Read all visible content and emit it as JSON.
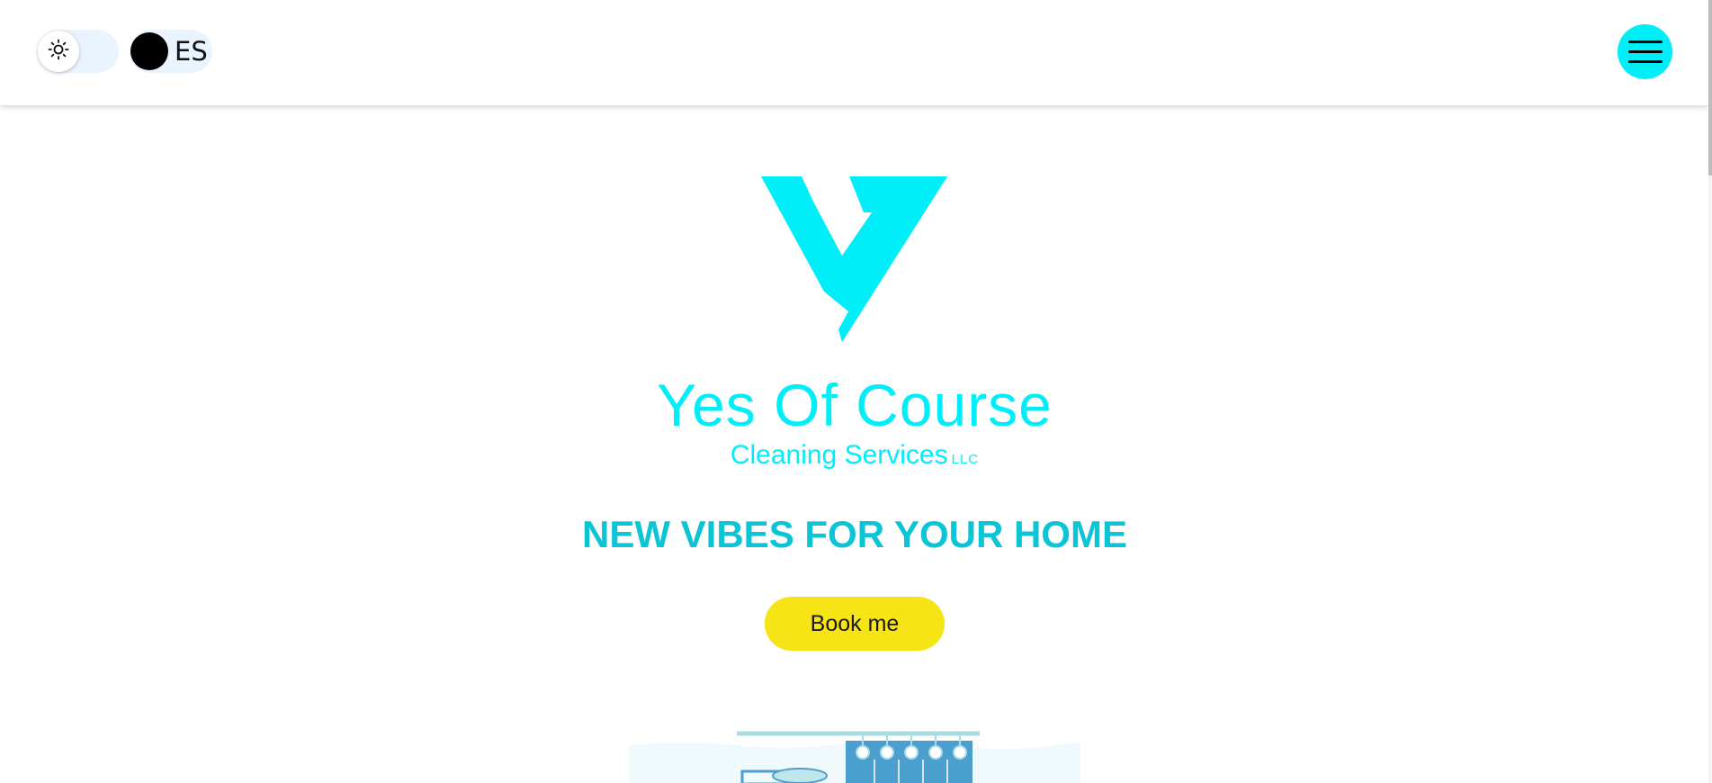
{
  "header": {
    "theme_toggle": {
      "icon": "sun-icon",
      "mode": "light"
    },
    "language_toggle": {
      "label": "ES"
    },
    "menu_button": {
      "icon": "hamburger-icon"
    }
  },
  "hero": {
    "logo_mark": "logo-v-icon",
    "brand_name": "Yes Of Course",
    "brand_subtitle": "Cleaning Services",
    "brand_suffix": "LLC",
    "tagline": "NEW VIBES FOR YOUR HOME",
    "cta_label": "Book me",
    "illustration": "bathroom-illustration"
  },
  "colors": {
    "accent": "#00eef8",
    "tagline": "#0bc4d6",
    "cta": "#f7e417",
    "toggle_track": "#eaf4ff"
  }
}
